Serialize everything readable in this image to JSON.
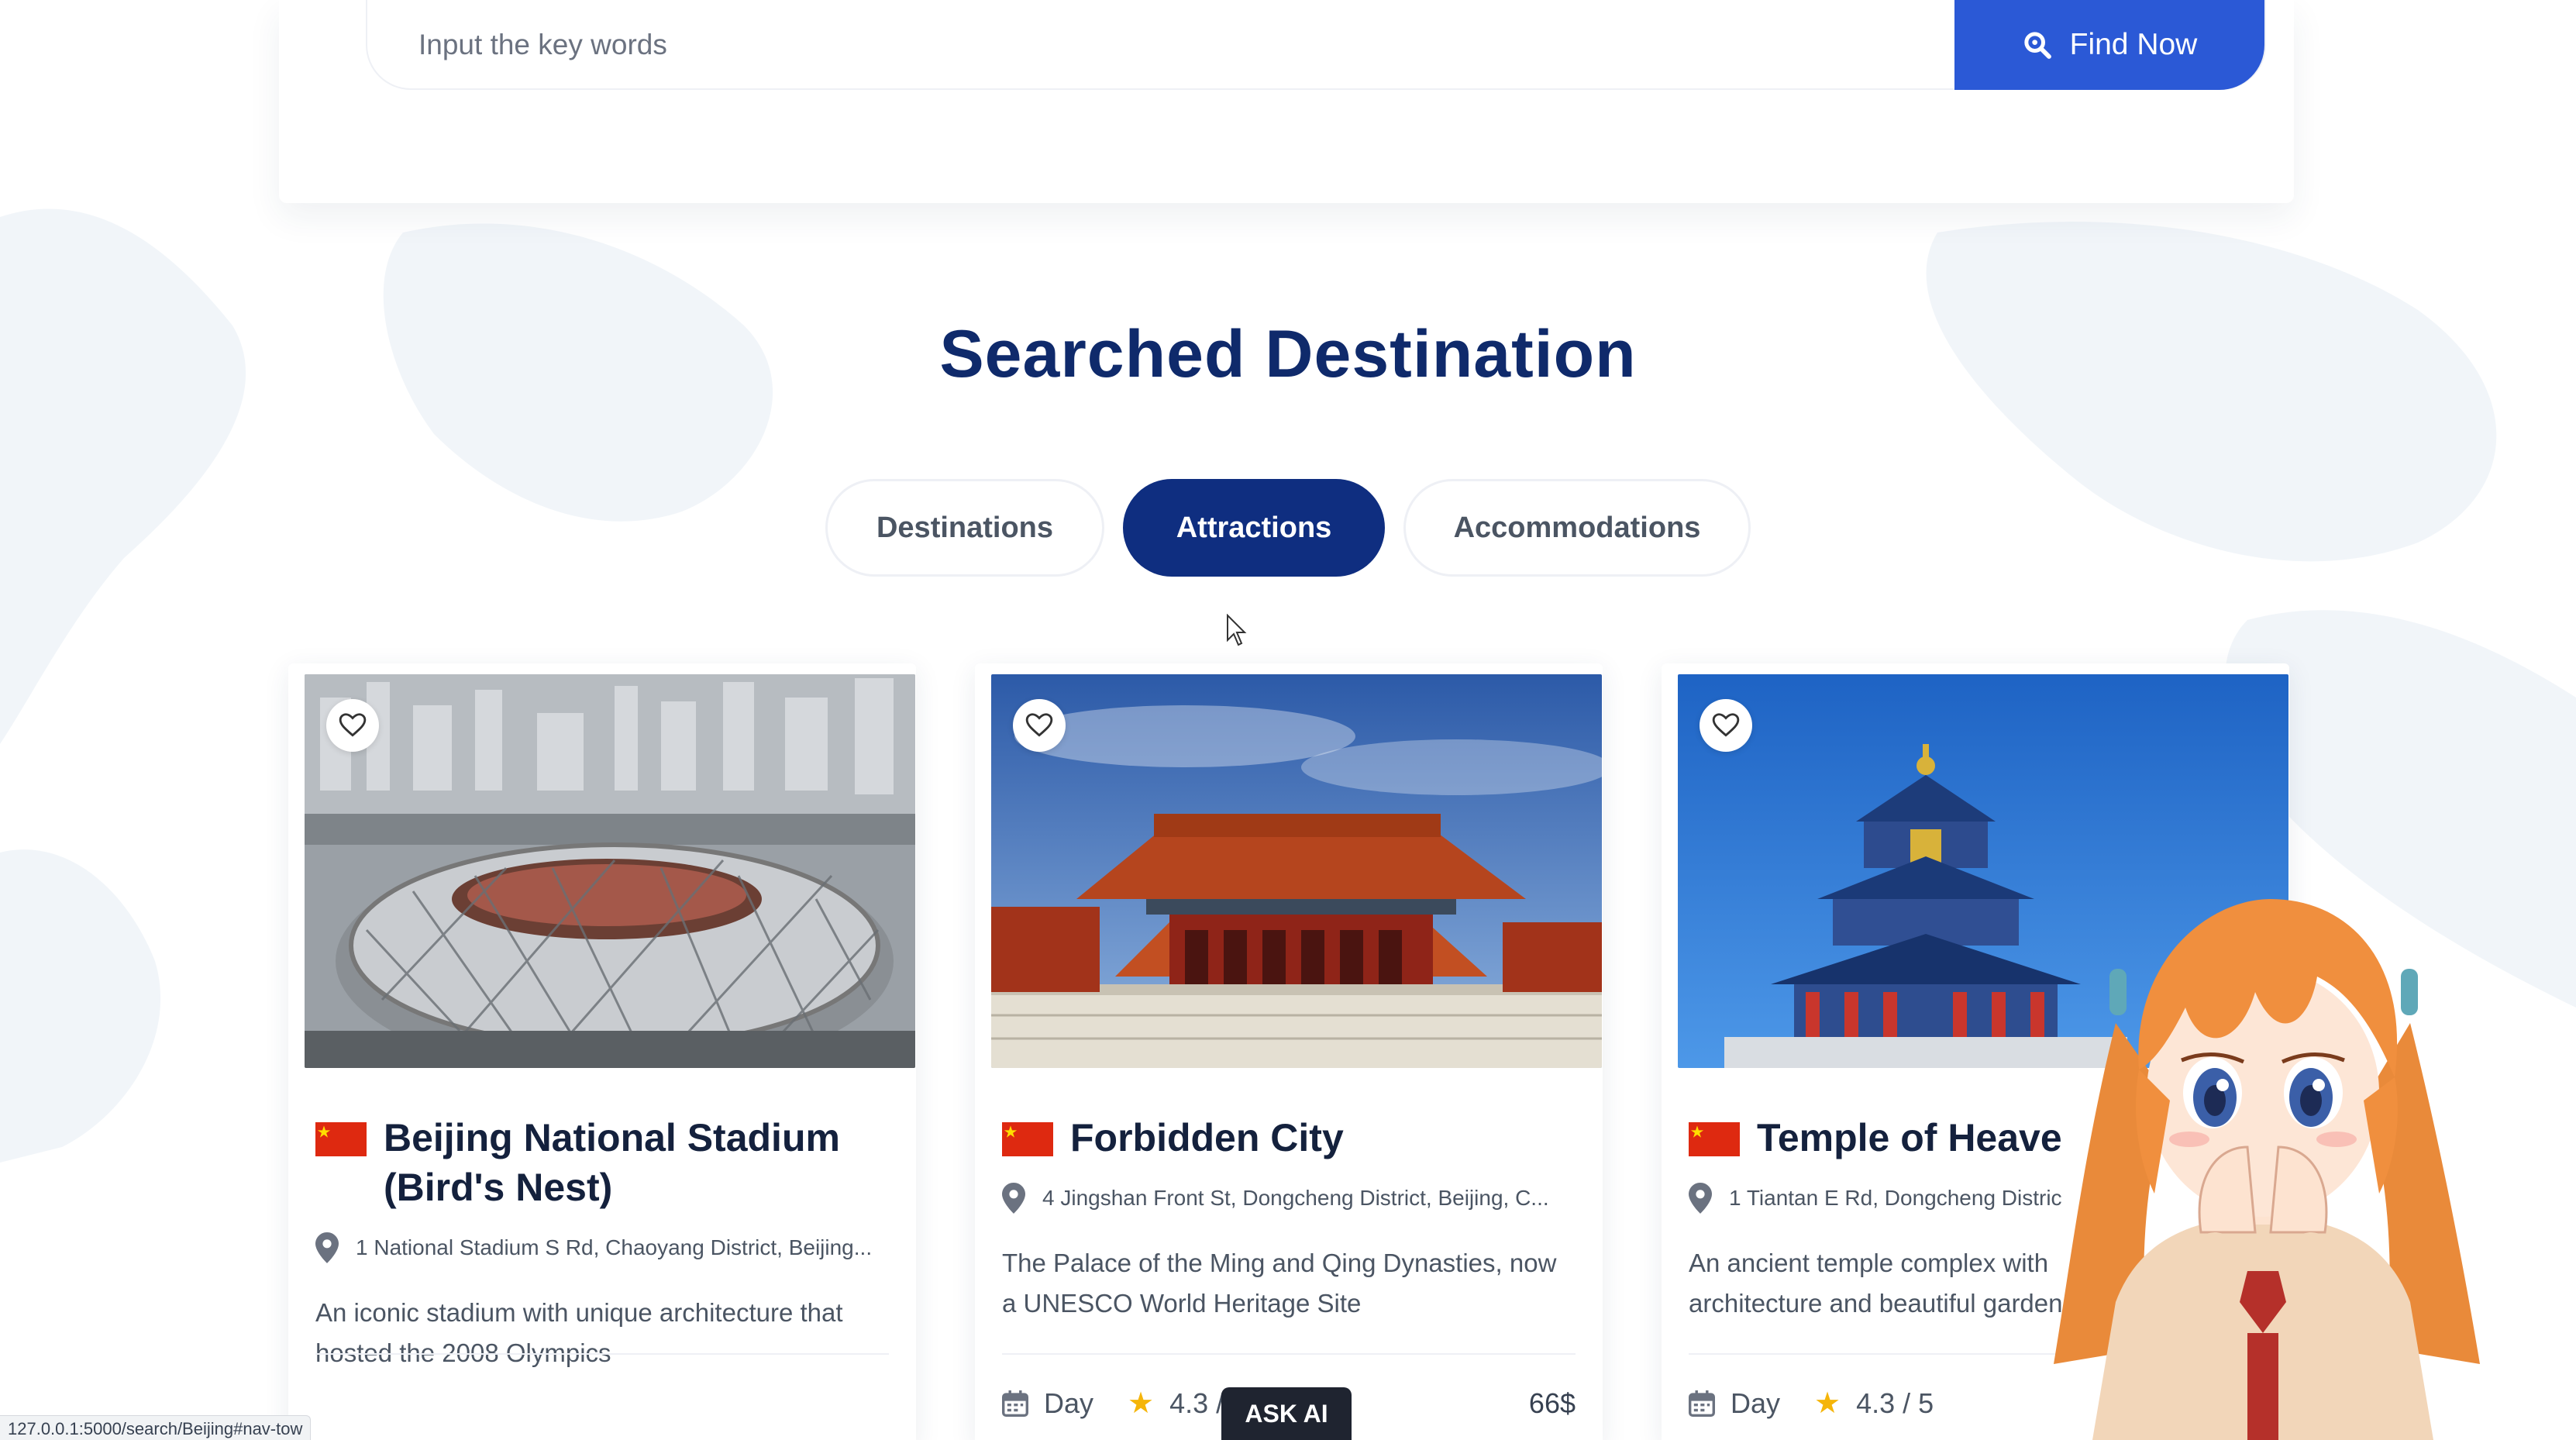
{
  "search": {
    "placeholder": "Input the key words",
    "button_label": "Find Now"
  },
  "section_title": "Searched Destination",
  "tabs": [
    {
      "label": "Destinations",
      "active": false
    },
    {
      "label": "Attractions",
      "active": true
    },
    {
      "label": "Accommodations",
      "active": false
    }
  ],
  "cards": [
    {
      "title": "Beijing National Stadium (Bird's Nest)",
      "address": "1 National Stadium S Rd, Chaoyang District, Beijing...",
      "description": "An iconic stadium with unique architecture that hosted the 2008 Olympics"
    },
    {
      "title": "Forbidden City",
      "address": "4 Jingshan Front St, Dongcheng District, Beijing, C...",
      "description": "The Palace of the Ming and Qing Dynasties, now a UNESCO World Heritage Site",
      "duration": "Day",
      "rating": "4.3 /",
      "price": "66$"
    },
    {
      "title": "Temple of Heave",
      "address": "1 Tiantan E Rd, Dongcheng Distric",
      "description_line1": "An ancient temple complex with",
      "description_line2": "architecture and beautiful gardens",
      "duration": "Day",
      "rating": "4.3 / 5"
    }
  ],
  "ask_ai_label": "ASK AI",
  "status_url": "127.0.0.1:5000/search/Beijing#nav-tow",
  "colors": {
    "primary": "#2b59d6",
    "heading": "#0f2a6b",
    "active_tab": "#0f2e80",
    "star": "#f5b50a",
    "flag_red": "#de2910",
    "flag_yellow": "#ffde00"
  },
  "icons": [
    "search-icon",
    "heart-icon",
    "location-pin-icon",
    "calendar-icon",
    "star-icon",
    "china-flag-icon",
    "mouse-cursor-icon"
  ]
}
